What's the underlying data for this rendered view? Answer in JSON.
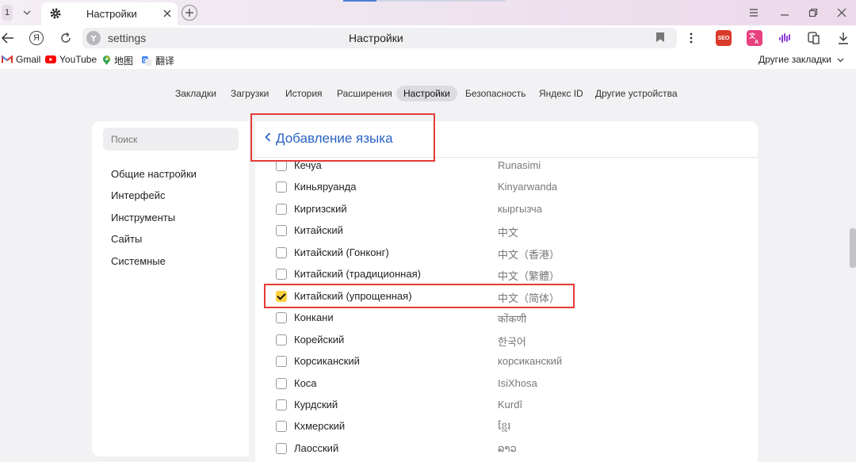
{
  "tabstrip": {
    "tab_count": "1",
    "active_tab_title": "Настройки"
  },
  "toolbar": {
    "yandex_button": "Я",
    "address_url": "settings",
    "address_title": "Настройки"
  },
  "bookmarks": {
    "items": [
      "Gmail",
      "YouTube",
      "地图",
      "翻译"
    ],
    "other": "Другие закладки"
  },
  "section_nav": {
    "items": [
      "Закладки",
      "Загрузки",
      "История",
      "Расширения",
      "Настройки",
      "Безопасность",
      "Яндекс ID",
      "Другие устройства"
    ],
    "active": "Настройки"
  },
  "left_panel": {
    "search_placeholder": "Поиск",
    "menu": [
      "Общие настройки",
      "Интерфейс",
      "Инструменты",
      "Сайты",
      "Системные"
    ]
  },
  "language_panel": {
    "header": "Добавление языка",
    "languages": [
      {
        "ru": "Кечуа",
        "native": "Runasimi",
        "checked": false
      },
      {
        "ru": "Киньяруанда",
        "native": "Kinyarwanda",
        "checked": false
      },
      {
        "ru": "Киргизский",
        "native": "кыргызча",
        "checked": false
      },
      {
        "ru": "Китайский",
        "native": "中文",
        "checked": false
      },
      {
        "ru": "Китайский (Гонконг)",
        "native": "中文（香港）",
        "checked": false
      },
      {
        "ru": "Китайский (традиционная)",
        "native": "中文（繁體）",
        "checked": false
      },
      {
        "ru": "Китайский (упрощенная)",
        "native": "中文（简体）",
        "checked": true
      },
      {
        "ru": "Конкани",
        "native": "कोंकणी",
        "checked": false
      },
      {
        "ru": "Корейский",
        "native": "한국어",
        "checked": false
      },
      {
        "ru": "Корсиканский",
        "native": "корсиканский",
        "checked": false
      },
      {
        "ru": "Коса",
        "native": "IsiXhosa",
        "checked": false
      },
      {
        "ru": "Курдский",
        "native": "Kurdî",
        "checked": false
      },
      {
        "ru": "Кхмерский",
        "native": "ខ្មែរ",
        "checked": false
      },
      {
        "ru": "Лаосский",
        "native": "ລາວ",
        "checked": false
      }
    ]
  },
  "colors": {
    "accent": "#2b63c6",
    "checkbox_checked": "#fcd33d",
    "highlight": "#e53a35"
  }
}
